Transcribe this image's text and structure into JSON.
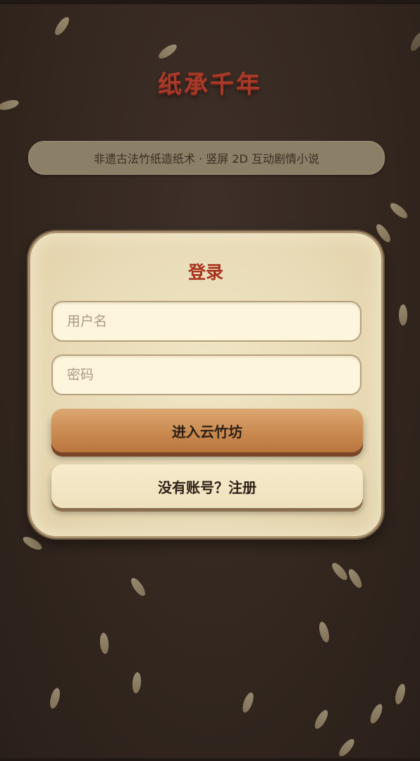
{
  "header": {
    "title": "纸承千年",
    "subtitle": "非遗古法竹纸造纸术 · 竖屏 2D 互动剧情小说"
  },
  "login": {
    "title": "登录",
    "username_placeholder": "用户名",
    "password_placeholder": "密码",
    "submit_label": "进入云竹坊",
    "register_label": "没有账号？注册"
  },
  "colors": {
    "background": "#33271f",
    "title_red": "#a83a2a",
    "card": "#ede0bd",
    "primary_button": "#c98a50",
    "leaf": "#c9b78f"
  },
  "decorations": {
    "falling_leaf_icon": "bamboo-leaf-icon"
  }
}
